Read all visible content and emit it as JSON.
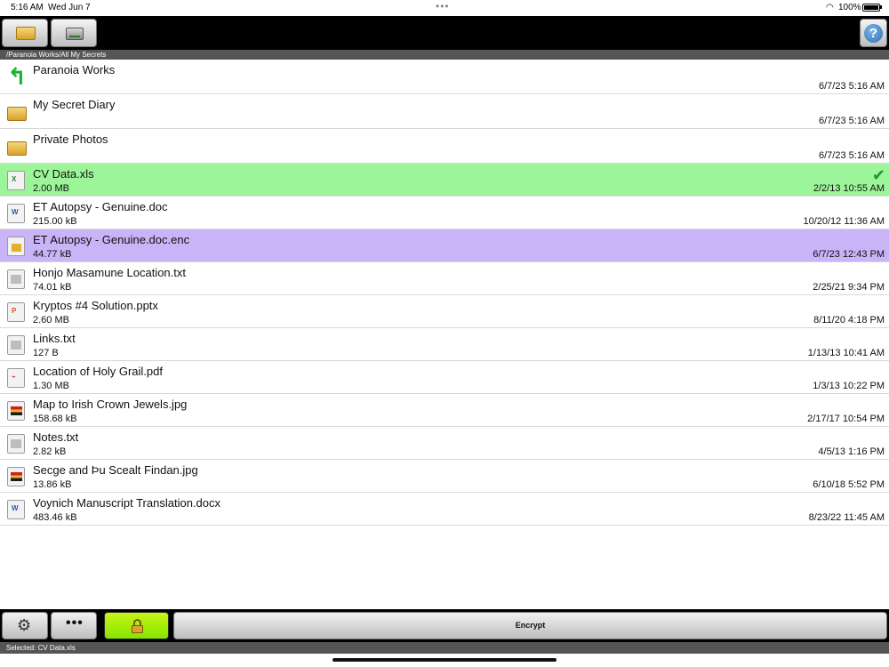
{
  "status": {
    "time": "5:16 AM",
    "date": "Wed Jun 7",
    "battery": "100%"
  },
  "toolbar": {
    "left_buttons": [
      "folder-icon",
      "drive-icon"
    ],
    "help_label": "?"
  },
  "path": "/Paranoia Works/All My Secrets",
  "items": [
    {
      "name": "Paranoia Works",
      "size": "",
      "date": "6/7/23 5:16 AM",
      "kind": "up"
    },
    {
      "name": "My Secret Diary",
      "size": "",
      "date": "6/7/23 5:16 AM",
      "kind": "folder"
    },
    {
      "name": "Private Photos",
      "size": "",
      "date": "6/7/23 5:16 AM",
      "kind": "folder"
    },
    {
      "name": "CV Data.xls",
      "size": "2.00 MB",
      "date": "2/2/13 10:55 AM",
      "kind": "xls",
      "state": "selected"
    },
    {
      "name": "ET Autopsy - Genuine.doc",
      "size": "215.00 kB",
      "date": "10/20/12 11:36 AM",
      "kind": "doc"
    },
    {
      "name": "ET Autopsy - Genuine.doc.enc",
      "size": "44.77 kB",
      "date": "6/7/23 12:43 PM",
      "kind": "enc",
      "state": "encrypted"
    },
    {
      "name": "Honjo Masamune Location.txt",
      "size": "74.01 kB",
      "date": "2/25/21 9:34 PM",
      "kind": "txt"
    },
    {
      "name": "Kryptos #4 Solution.pptx",
      "size": "2.60 MB",
      "date": "8/11/20 4:18 PM",
      "kind": "ppt"
    },
    {
      "name": "Links.txt",
      "size": "127 B",
      "date": "1/13/13 10:41 AM",
      "kind": "txt"
    },
    {
      "name": "Location of Holy Grail.pdf",
      "size": "1.30 MB",
      "date": "1/3/13 10:22 PM",
      "kind": "pdf"
    },
    {
      "name": "Map to Irish Crown Jewels.jpg",
      "size": "158.68 kB",
      "date": "2/17/17 10:54 PM",
      "kind": "jpg"
    },
    {
      "name": "Notes.txt",
      "size": "2.82 kB",
      "date": "4/5/13 1:16 PM",
      "kind": "txt"
    },
    {
      "name": "Secge and Þu Scealt Findan.jpg",
      "size": "13.86 kB",
      "date": "6/10/18 5:52 PM",
      "kind": "jpg"
    },
    {
      "name": "Voynich Manuscript Translation.docx",
      "size": "483.46 kB",
      "date": "8/23/22 11:45 AM",
      "kind": "doc"
    }
  ],
  "bottom": {
    "more_label": "•••",
    "encrypt_label": "Encrypt"
  },
  "selected_text": "Selected: CV Data.xls",
  "colors": {
    "selected_row": "#9df59a",
    "encrypted_row": "#c8b4f6",
    "lock_button": "#a8ed0a"
  }
}
